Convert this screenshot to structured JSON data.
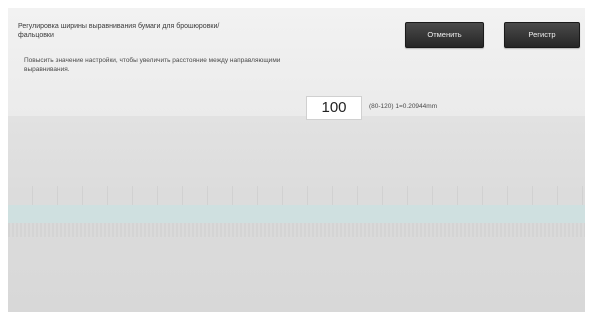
{
  "header": {
    "title": "Регулировка ширины выравнивания бумаги для брошюровки/фальцовки",
    "hint": "Повысить значение настройки, чтобы увеличить расстояние между направляющими выравнивания."
  },
  "buttons": {
    "cancel_label": "Отменить",
    "register_label": "Регистр"
  },
  "setting": {
    "value": "100",
    "range_text": "(80-120) 1=0.20944mm"
  },
  "colors": {
    "button_bg": "#2e2e2e",
    "highlight_band": "#cfe0e0"
  }
}
